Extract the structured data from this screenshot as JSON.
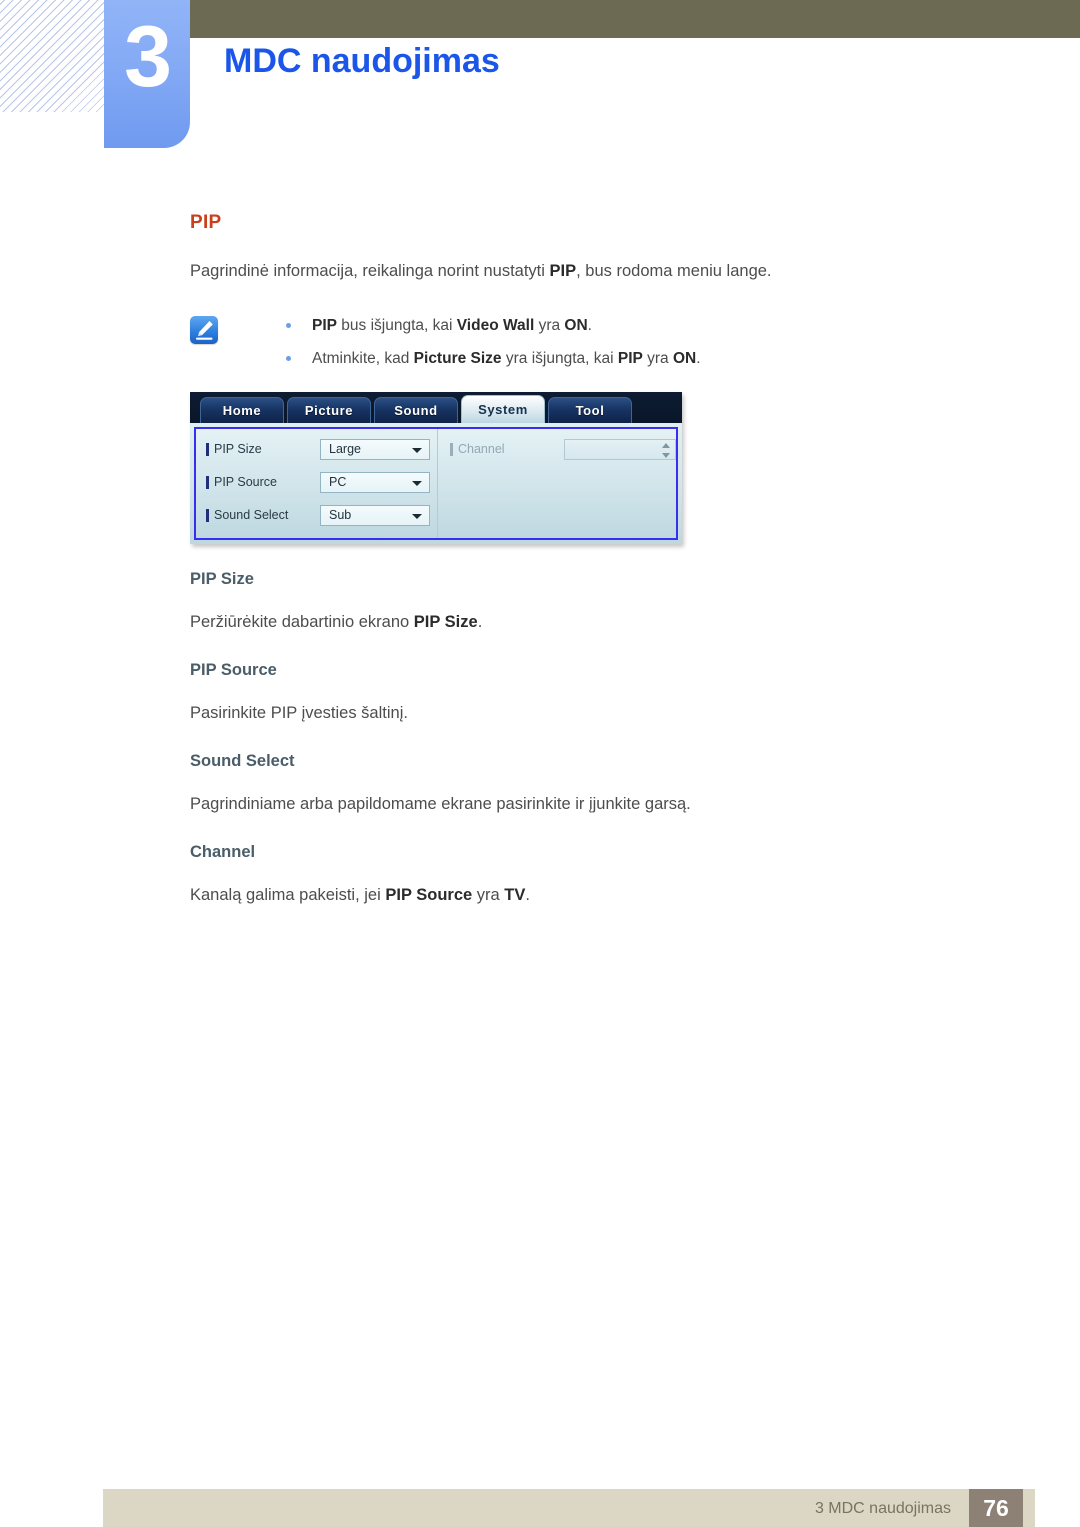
{
  "header": {
    "chapter_number": "3",
    "chapter_title": "MDC naudojimas",
    "accent_blue": "#1b56e8",
    "tab_blue": "#84aaf5",
    "olive": "#6d6a54"
  },
  "content": {
    "topic_heading": "PIP",
    "topic_color": "#c8401c",
    "intro_before": "Pagrindinė informacija, reikalinga norint nustatyti ",
    "intro_bold": "PIP",
    "intro_after": ", bus rodoma meniu lange.",
    "note_icon": "note-pencil-icon",
    "notes": [
      {
        "b1": "PIP",
        "t1": " bus išjungta, kai ",
        "b2": "Video Wall",
        "t2": " yra ",
        "b3": "ON",
        "t3": "."
      },
      {
        "b1": "Atminkite, kad",
        "t1": " ",
        "b2": "Picture Size",
        "t2": " yra išjungta, kai ",
        "b3": "PIP",
        "t3": " yra ",
        "b4": "ON",
        "t4": "."
      }
    ]
  },
  "mdc_dialog": {
    "tabs": [
      {
        "label": "Home",
        "active": false
      },
      {
        "label": "Picture",
        "active": false
      },
      {
        "label": "Sound",
        "active": false
      },
      {
        "label": "System",
        "active": true
      },
      {
        "label": "Tool",
        "active": false
      }
    ],
    "left_fields": [
      {
        "label": "PIP Size",
        "value": "Large",
        "control": "dropdown",
        "disabled": false
      },
      {
        "label": "PIP Source",
        "value": "PC",
        "control": "dropdown",
        "disabled": false
      },
      {
        "label": "Sound Select",
        "value": "Sub",
        "control": "dropdown",
        "disabled": false
      }
    ],
    "right_fields": [
      {
        "label": "Channel",
        "value": "",
        "control": "spinner",
        "disabled": true
      }
    ],
    "highlight_color": "#3b2df0"
  },
  "sections": [
    {
      "title": "PIP Size",
      "body_before": "Peržiūrėkite dabartinio ekrano ",
      "body_bold": "PIP Size",
      "body_after": "."
    },
    {
      "title": "PIP Source",
      "body_before": "Pasirinkite PIP įvesties šaltinį.",
      "body_bold": "",
      "body_after": ""
    },
    {
      "title": "Sound Select",
      "body_before": "Pagrindiniame arba papildomame ekrane pasirinkite ir įjunkite garsą.",
      "body_bold": "",
      "body_after": ""
    },
    {
      "title": "Channel",
      "body_before": "Kanalą galima pakeisti, jei ",
      "body_bold": "PIP Source",
      "body_mid": " yra ",
      "body_bold2": "TV",
      "body_after": "."
    }
  ],
  "footer": {
    "text": "3 MDC naudojimas",
    "page_number": "76",
    "bar_color": "#dcd7c4",
    "page_box_color": "#8d8175"
  }
}
